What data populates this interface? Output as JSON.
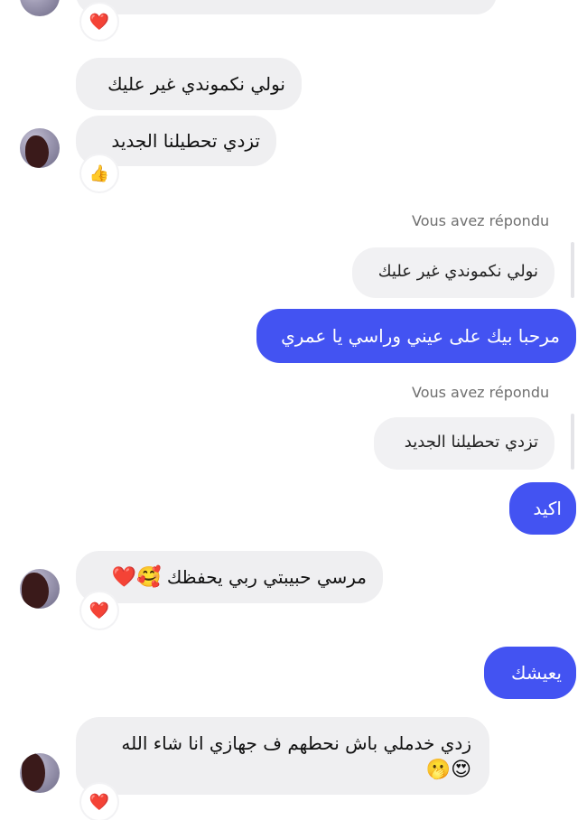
{
  "messages": {
    "m1": {
      "text": "نولي نكموندي غير عليك"
    },
    "m2": {
      "text": "تزدي تحطيلنا الجديد",
      "reaction": "👍"
    },
    "reply1": {
      "meta": "Vous avez répondu",
      "quoted": "نولي نكموندي غير عليك",
      "text": "مرحبا بيك على عيني وراسي يا عمري"
    },
    "reply2": {
      "meta": "Vous avez répondu",
      "quoted": "تزدي تحطيلنا الجديد",
      "text": "اكيد"
    },
    "m3": {
      "text": "مرسي حبيبتي ربي يحفظك",
      "emoji": "🥰❤️",
      "reaction": "❤️"
    },
    "m4": {
      "text": "يعيشك"
    },
    "m5": {
      "text": "زدي خدملي باش نحطهم ف جهازي انا شاء الله",
      "emoji": "😍🫢",
      "reaction": "❤️"
    },
    "top": {
      "reaction": "❤️"
    }
  },
  "colors": {
    "outgoing": "#4353f2",
    "incoming": "#efeff1",
    "meta": "#6f6f6f"
  }
}
